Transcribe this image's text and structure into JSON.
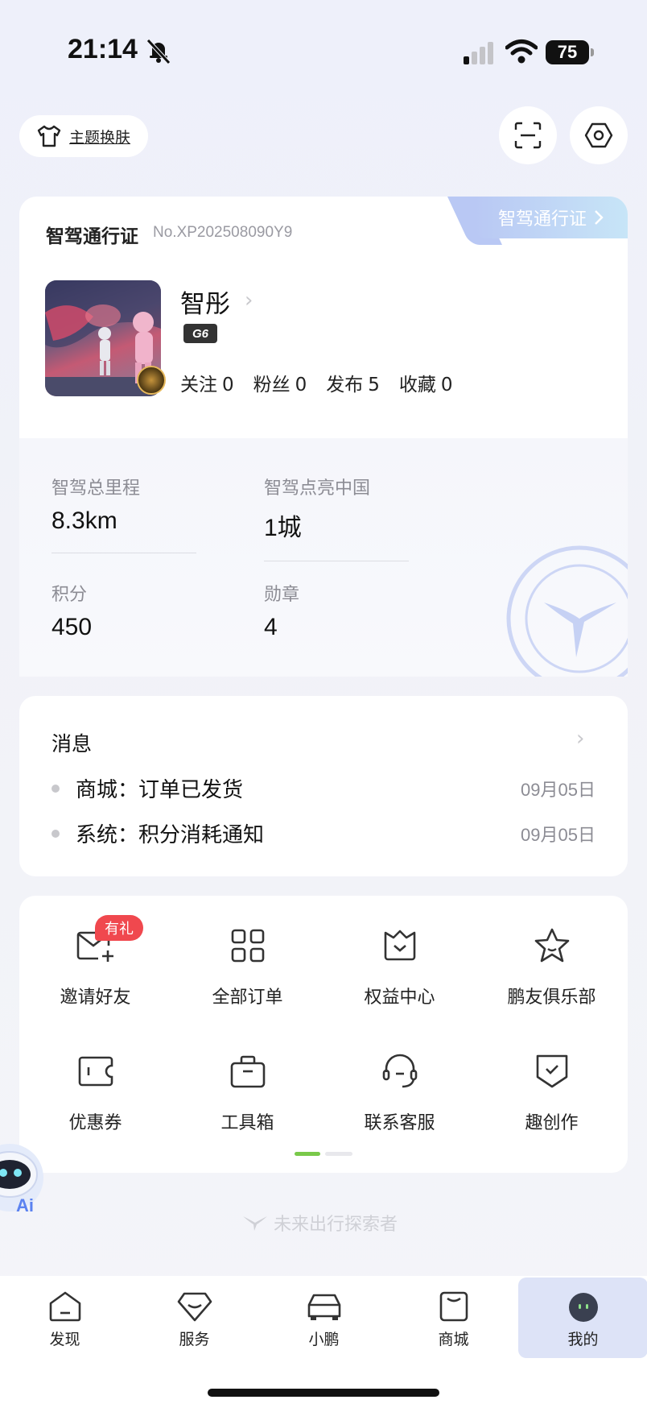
{
  "status_bar": {
    "time": "21:14",
    "battery": "75"
  },
  "top": {
    "theme_label": "主题换肤"
  },
  "passport": {
    "title": "智驾通行证",
    "number": "No.XP202508090Y9",
    "tab_label": "智驾通行证",
    "username": "智彤",
    "model": "G6",
    "stats": [
      {
        "label": "关注",
        "value": "0"
      },
      {
        "label": "粉丝",
        "value": "0"
      },
      {
        "label": "发布",
        "value": "5"
      },
      {
        "label": "收藏",
        "value": "0"
      }
    ],
    "metrics": [
      {
        "label": "智驾总里程",
        "value": "8.3km"
      },
      {
        "label": "智驾点亮中国",
        "value": "1城"
      },
      {
        "label": "积分",
        "value": "450"
      },
      {
        "label": "勋章",
        "value": "4"
      }
    ]
  },
  "messages": {
    "title": "消息",
    "items": [
      {
        "text": "商城：订单已发货",
        "date": "09月05日"
      },
      {
        "text": "系统：积分消耗通知",
        "date": "09月05日"
      }
    ]
  },
  "shortcuts": {
    "gift_badge": "有礼",
    "items": [
      {
        "label": "邀请好友",
        "icon": "invite-mail-icon"
      },
      {
        "label": "全部订单",
        "icon": "grid-icon"
      },
      {
        "label": "权益中心",
        "icon": "crown-box-icon"
      },
      {
        "label": "鹏友俱乐部",
        "icon": "star-icon"
      },
      {
        "label": "优惠券",
        "icon": "coupon-icon"
      },
      {
        "label": "工具箱",
        "icon": "toolbox-icon"
      },
      {
        "label": "联系客服",
        "icon": "headset-icon"
      },
      {
        "label": "趣创作",
        "icon": "shield-check-icon"
      }
    ]
  },
  "slogan": "未来出行探索者",
  "ai_label": "Ai",
  "tabbar": {
    "items": [
      {
        "label": "发现"
      },
      {
        "label": "服务"
      },
      {
        "label": "小鹏"
      },
      {
        "label": "商城"
      },
      {
        "label": "我的"
      }
    ]
  }
}
